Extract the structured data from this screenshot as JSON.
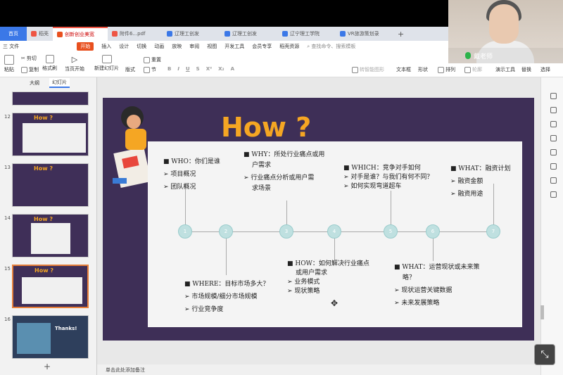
{
  "tabs": {
    "home": "首页",
    "items": [
      {
        "label": "稻壳",
        "color": "#e54"
      },
      {
        "label": "创新创业美宽",
        "color": "#e8501f"
      },
      {
        "label": "附件6...pdf",
        "color": "#e54"
      },
      {
        "label": "辽理工创发",
        "color": "#3b78e7"
      },
      {
        "label": "辽理工创发",
        "color": "#3b78e7"
      },
      {
        "label": "辽宁理工学院",
        "color": "#3b78e7"
      },
      {
        "label": "VR旅游策划录",
        "color": "#3b78e7"
      }
    ],
    "add": "+"
  },
  "menu": {
    "file": "三 文件",
    "start": "开始",
    "items": [
      "插入",
      "设计",
      "切换",
      "动画",
      "放映",
      "审阅",
      "视图",
      "开发工具",
      "会员专享",
      "稻壳资源"
    ],
    "search": "查找命令、搜索模板"
  },
  "ribbon": {
    "paste": "粘贴",
    "cut": "剪切",
    "copy": "复制",
    "format_painter": "格式刷",
    "current_start": "当页开始",
    "new_slide": "新建幻灯片",
    "layout": "版式",
    "section": "节",
    "reset": "重置",
    "text_box": "文本框",
    "shape": "形状",
    "arrange": "排列",
    "outline": "轮廓",
    "presenter": "演示工具",
    "replace": "替换",
    "select": "选择",
    "smart_graphic": "转智能图形",
    "text_box2": "文本框",
    "arrange2": "排列"
  },
  "video": {
    "name": "戴老师"
  },
  "left_panel": {
    "tab_outline": "大纲",
    "tab_slides": "幻灯片",
    "thumbs": [
      {
        "num": "12",
        "title": "How ?"
      },
      {
        "num": "13",
        "title": "How ?"
      },
      {
        "num": "14",
        "title": "How ?"
      },
      {
        "num": "15",
        "title": "How ?"
      },
      {
        "num": "16",
        "title": "Thanks!"
      }
    ],
    "add": "+"
  },
  "slide": {
    "title": "How ?",
    "who_title": "WHO：你们是谁",
    "who_items": [
      "项目概况",
      "团队概况"
    ],
    "why_title_1": "WHY：所处行业痛点或用",
    "why_title_2": "户需求",
    "why_items_1": "行业痛点分析或用户需",
    "why_items_2": "求场景",
    "which_title": "WHICH：竞争对手如何",
    "which_items": [
      "对手是谁？与我们有何不同？",
      "如何实现弯道超车"
    ],
    "what_title": "WHAT：融资计划",
    "what_items": [
      "融资金额",
      "融资用途"
    ],
    "where_title": "WHERE：目标市场多大？",
    "where_items": [
      "市场规模/细分市场规模",
      "行业竞争度"
    ],
    "how_title_1": "HOW：如何解决行业痛点",
    "how_title_2": "或用户需求",
    "how_items": [
      "业务模式",
      "现状策略"
    ],
    "what2_title_1": "WHAT：运营现状或未来策",
    "what2_title_2": "略？",
    "what2_items": [
      "现状运营关键数据",
      "未来发展策略"
    ],
    "dots": [
      "1",
      "2",
      "3",
      "4",
      "5",
      "6",
      "7"
    ]
  },
  "status": {
    "notes": "单击此处添加备注"
  },
  "colors": {
    "slide_bg": "#3e2f57",
    "title": "#f5a623",
    "accent": "#e8501f"
  }
}
